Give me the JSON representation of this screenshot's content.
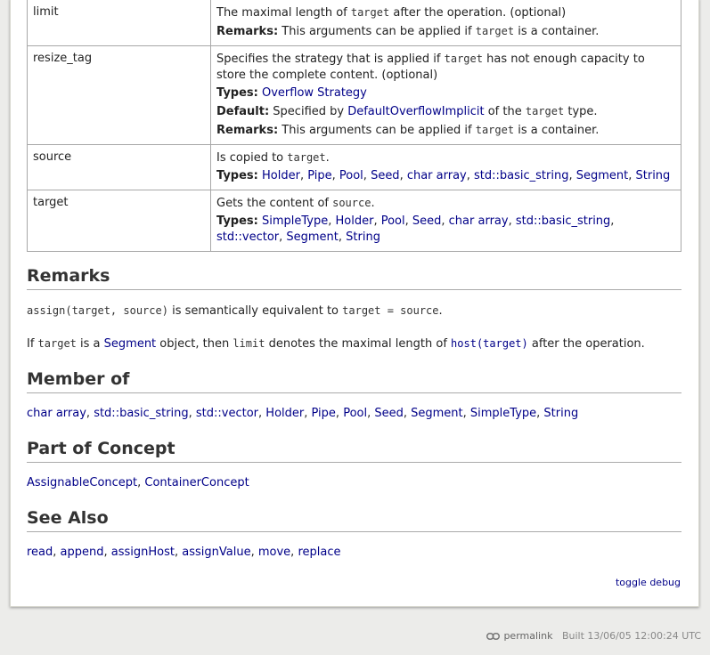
{
  "params": [
    {
      "name": "limit",
      "lines": [
        {
          "parts": [
            {
              "t": "text",
              "v": "The maximal length of "
            },
            {
              "t": "code",
              "v": "target"
            },
            {
              "t": "text",
              "v": " after the operation. (optional)"
            }
          ]
        },
        {
          "parts": [
            {
              "t": "bold",
              "v": "Remarks:"
            },
            {
              "t": "text",
              "v": " This arguments can be applied if "
            },
            {
              "t": "code",
              "v": "target"
            },
            {
              "t": "text",
              "v": " is a container."
            }
          ]
        }
      ]
    },
    {
      "name": "resize_tag",
      "lines": [
        {
          "parts": [
            {
              "t": "text",
              "v": "Specifies the strategy that is applied if "
            },
            {
              "t": "code",
              "v": "target"
            },
            {
              "t": "text",
              "v": " has not enough capacity to store the complete content. (optional)"
            }
          ]
        },
        {
          "parts": [
            {
              "t": "bold",
              "v": "Types:"
            },
            {
              "t": "text",
              "v": " "
            },
            {
              "t": "link",
              "v": "Overflow Strategy"
            }
          ]
        },
        {
          "parts": [
            {
              "t": "bold",
              "v": "Default:"
            },
            {
              "t": "text",
              "v": " Specified by "
            },
            {
              "t": "link",
              "v": "DefaultOverflowImplicit"
            },
            {
              "t": "text",
              "v": " of the "
            },
            {
              "t": "code",
              "v": "target"
            },
            {
              "t": "text",
              "v": " type."
            }
          ]
        },
        {
          "parts": [
            {
              "t": "bold",
              "v": "Remarks:"
            },
            {
              "t": "text",
              "v": " This arguments can be applied if "
            },
            {
              "t": "code",
              "v": "target"
            },
            {
              "t": "text",
              "v": " is a container."
            }
          ]
        }
      ]
    },
    {
      "name": "source",
      "lines": [
        {
          "parts": [
            {
              "t": "text",
              "v": "Is copied to "
            },
            {
              "t": "code",
              "v": "target"
            },
            {
              "t": "text",
              "v": "."
            }
          ]
        },
        {
          "parts": [
            {
              "t": "bold",
              "v": "Types:"
            },
            {
              "t": "text",
              "v": " "
            },
            {
              "t": "link",
              "v": "Holder"
            },
            {
              "t": "text",
              "v": ", "
            },
            {
              "t": "link",
              "v": "Pipe"
            },
            {
              "t": "text",
              "v": ", "
            },
            {
              "t": "link",
              "v": "Pool"
            },
            {
              "t": "text",
              "v": ", "
            },
            {
              "t": "link",
              "v": "Seed"
            },
            {
              "t": "text",
              "v": ", "
            },
            {
              "t": "link",
              "v": "char array"
            },
            {
              "t": "text",
              "v": ", "
            },
            {
              "t": "link",
              "v": "std::basic_string"
            },
            {
              "t": "text",
              "v": ", "
            },
            {
              "t": "link",
              "v": "Segment"
            },
            {
              "t": "text",
              "v": ", "
            },
            {
              "t": "link",
              "v": "String"
            }
          ]
        }
      ]
    },
    {
      "name": "target",
      "lines": [
        {
          "parts": [
            {
              "t": "text",
              "v": "Gets the content of "
            },
            {
              "t": "code",
              "v": "source"
            },
            {
              "t": "text",
              "v": "."
            }
          ]
        },
        {
          "parts": [
            {
              "t": "bold",
              "v": "Types:"
            },
            {
              "t": "text",
              "v": " "
            },
            {
              "t": "link",
              "v": "SimpleType"
            },
            {
              "t": "text",
              "v": ", "
            },
            {
              "t": "link",
              "v": "Holder"
            },
            {
              "t": "text",
              "v": ", "
            },
            {
              "t": "link",
              "v": "Pool"
            },
            {
              "t": "text",
              "v": ", "
            },
            {
              "t": "link",
              "v": "Seed"
            },
            {
              "t": "text",
              "v": ", "
            },
            {
              "t": "link",
              "v": "char array"
            },
            {
              "t": "text",
              "v": ", "
            },
            {
              "t": "link",
              "v": "std::basic_string"
            },
            {
              "t": "text",
              "v": ", "
            },
            {
              "t": "link",
              "v": "std::vector"
            },
            {
              "t": "text",
              "v": ", "
            },
            {
              "t": "link",
              "v": "Segment"
            },
            {
              "t": "text",
              "v": ", "
            },
            {
              "t": "link",
              "v": "String"
            }
          ]
        }
      ]
    }
  ],
  "remarks": {
    "heading": "Remarks",
    "p1": [
      {
        "t": "code",
        "v": "assign(target, source)"
      },
      {
        "t": "text",
        "v": " is semantically equivalent to "
      },
      {
        "t": "code",
        "v": "target = source"
      },
      {
        "t": "text",
        "v": "."
      }
    ],
    "p2": [
      {
        "t": "text",
        "v": "If "
      },
      {
        "t": "code",
        "v": "target"
      },
      {
        "t": "text",
        "v": " is a "
      },
      {
        "t": "link",
        "v": "Segment"
      },
      {
        "t": "text",
        "v": " object, then "
      },
      {
        "t": "code",
        "v": "limit"
      },
      {
        "t": "text",
        "v": " denotes the maximal length of "
      },
      {
        "t": "codelink",
        "v": "host(target)"
      },
      {
        "t": "text",
        "v": " after the operation."
      }
    ]
  },
  "member_of": {
    "heading": "Member of",
    "links": [
      "char array",
      "std::basic_string",
      "std::vector",
      "Holder",
      "Pipe",
      "Pool",
      "Seed",
      "Segment",
      "SimpleType",
      "String"
    ]
  },
  "part_of_concept": {
    "heading": "Part of Concept",
    "links": [
      "AssignableConcept",
      "ContainerConcept"
    ]
  },
  "see_also": {
    "heading": "See Also",
    "links": [
      "read",
      "append",
      "assignHost",
      "assignValue",
      "move",
      "replace"
    ]
  },
  "toggle_debug": "toggle debug",
  "footer": {
    "permalink": "permalink",
    "built": "Built 13/06/05 12:00:24 UTC"
  },
  "colors": {
    "link": "#000088",
    "page_bg": "#ececea"
  }
}
